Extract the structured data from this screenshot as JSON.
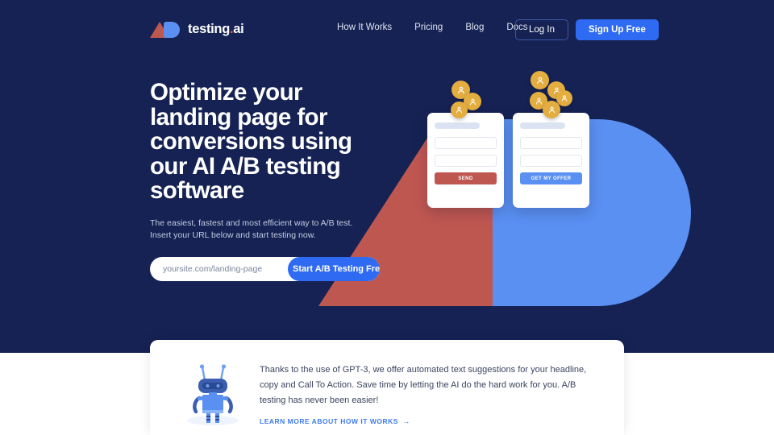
{
  "colors": {
    "navy": "#152253",
    "red": "#bf5751",
    "blue": "#5a90f2",
    "accent_blue": "#2f6bf2",
    "gold": "#e3ad3f",
    "white": "#ffffff"
  },
  "nav": {
    "logo": {
      "text": "testing",
      "dot": ".",
      "suffix": "ai",
      "triangle_icon": "letter-a-triangle-icon",
      "b_icon": "letter-b-shape-icon"
    },
    "links": [
      {
        "label": "How It Works"
      },
      {
        "label": "Pricing"
      },
      {
        "label": "Blog"
      },
      {
        "label": "Docs"
      }
    ],
    "login_label": "Log In",
    "signup_label": "Sign Up Free"
  },
  "hero": {
    "headline": "Optimize your landing page for conversions using our AI A/B testing software",
    "subtext": "The easiest, fastest and most efficient way to A/B test. Insert your URL below and start testing now.",
    "url_placeholder": "yoursite.com/landing-page",
    "url_value": "",
    "cta_label": "Start A/B Testing Free"
  },
  "variant_cards": [
    {
      "name": "variant-a",
      "button_label": "SEND",
      "button_color": "#bf5751",
      "fields": 2,
      "avatar_count": 3
    },
    {
      "name": "variant-b",
      "button_label": "GET MY OFFER",
      "button_color": "#5a90f2",
      "fields": 2,
      "avatar_count": 5
    }
  ],
  "background_art": {
    "letter_a": "A",
    "letter_b": "B"
  },
  "info_card": {
    "robot_icon": "robot-icon",
    "paragraph": "Thanks to the use of GPT-3, we offer automated text suggestions for your headline, copy and Call To Action. Save time by letting the AI do the hard work for you. A/B testing has never been easier!",
    "link_label": "LEARN MORE ABOUT HOW IT WORKS",
    "link_arrow": "→"
  }
}
